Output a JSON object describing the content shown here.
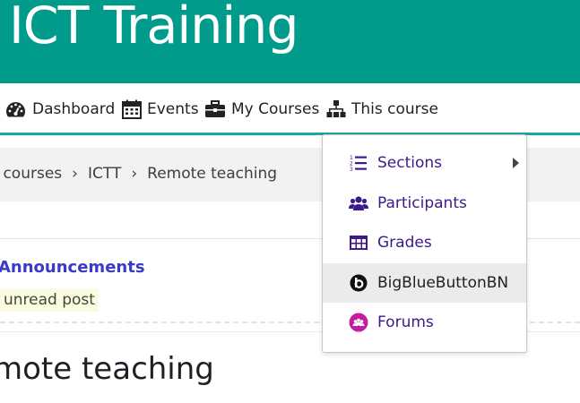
{
  "banner": {
    "title": "ICT Training",
    "color": "#009b8a"
  },
  "nav": {
    "items": [
      {
        "label": "Dashboard",
        "icon": "tachometer-icon"
      },
      {
        "label": "Events",
        "icon": "calendar-icon"
      },
      {
        "label": "My Courses",
        "icon": "briefcase-icon"
      },
      {
        "label": "This course",
        "icon": "sitemap-icon"
      }
    ]
  },
  "breadcrumb": {
    "items": [
      "y courses",
      "ICTT",
      "Remote teaching"
    ],
    "separator": "›"
  },
  "announcements": {
    "link": "Announcements",
    "unread": "unread post"
  },
  "section": {
    "title": "mote teaching"
  },
  "dropdown": {
    "items": [
      {
        "label": "Sections",
        "icon": "numbered-list-icon",
        "has_submenu": true
      },
      {
        "label": "Participants",
        "icon": "users-icon"
      },
      {
        "label": "Grades",
        "icon": "table-icon"
      },
      {
        "label": "BigBlueButtonBN",
        "icon": "bigbluebutton-icon",
        "highlighted": true
      },
      {
        "label": "Forums",
        "icon": "forum-icon"
      }
    ]
  }
}
